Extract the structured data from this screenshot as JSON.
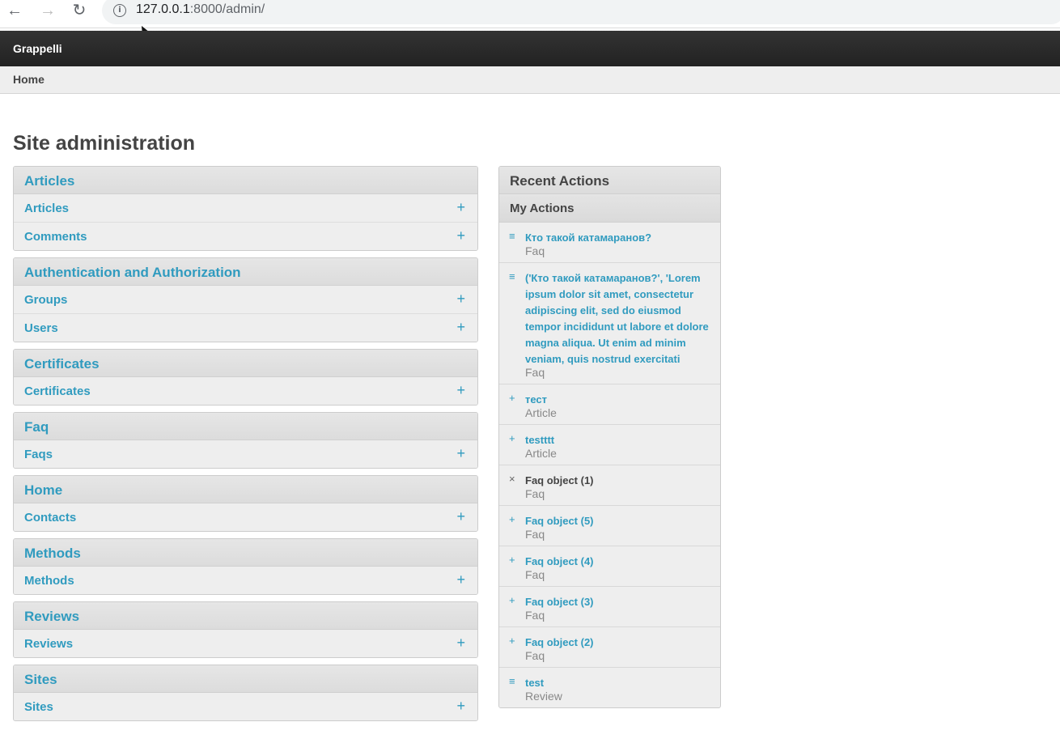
{
  "browser": {
    "url_host": "127.0.0.1",
    "url_path": ":8000/admin/"
  },
  "header": {
    "brand": "Grappelli"
  },
  "breadcrumb": {
    "home": "Home"
  },
  "page_title": "Site administration",
  "modules": [
    {
      "title": "Articles",
      "rows": [
        "Articles",
        "Comments"
      ]
    },
    {
      "title": "Authentication and Authorization",
      "rows": [
        "Groups",
        "Users"
      ]
    },
    {
      "title": "Certificates",
      "rows": [
        "Certificates"
      ]
    },
    {
      "title": "Faq",
      "rows": [
        "Faqs"
      ]
    },
    {
      "title": "Home",
      "rows": [
        "Contacts"
      ]
    },
    {
      "title": "Methods",
      "rows": [
        "Methods"
      ]
    },
    {
      "title": "Reviews",
      "rows": [
        "Reviews"
      ]
    },
    {
      "title": "Sites",
      "rows": [
        "Sites"
      ]
    }
  ],
  "recent_actions": {
    "title": "Recent Actions",
    "subtitle": "My Actions",
    "items": [
      {
        "icon": "change-icon",
        "title": "Кто такой катамаранов?",
        "type": "Faq",
        "deleted": false
      },
      {
        "icon": "change-icon",
        "title": "('Кто такой катамаранов?', 'Lorem ipsum dolor sit amet, consectetur adipiscing elit, sed do eiusmod tempor incididunt ut labore et dolore magna aliqua. Ut enim ad minim veniam, quis nostrud exercitati",
        "type": "Faq",
        "deleted": false
      },
      {
        "icon": "add-icon",
        "title": "тест",
        "type": "Article",
        "deleted": false
      },
      {
        "icon": "add-icon",
        "title": "testttt",
        "type": "Article",
        "deleted": false
      },
      {
        "icon": "delete-icon",
        "title": "Faq object (1)",
        "type": "Faq",
        "deleted": true
      },
      {
        "icon": "add-icon",
        "title": "Faq object (5)",
        "type": "Faq",
        "deleted": false
      },
      {
        "icon": "add-icon",
        "title": "Faq object (4)",
        "type": "Faq",
        "deleted": false
      },
      {
        "icon": "add-icon",
        "title": "Faq object (3)",
        "type": "Faq",
        "deleted": false
      },
      {
        "icon": "add-icon",
        "title": "Faq object (2)",
        "type": "Faq",
        "deleted": false
      },
      {
        "icon": "change-icon",
        "title": "test",
        "type": "Review",
        "deleted": false
      }
    ]
  },
  "colors": {
    "link": "#309bbf",
    "header_bg": "#2a2a2a",
    "panel_bg": "#eeeeee"
  }
}
